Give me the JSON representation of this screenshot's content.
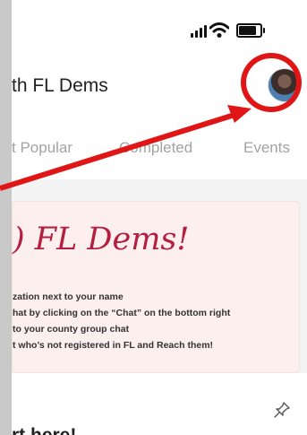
{
  "header": {
    "title": "th FL Dems"
  },
  "tabs": [
    {
      "label": "t Popular"
    },
    {
      "label": "Completed"
    },
    {
      "label": "Events"
    }
  ],
  "announcement": {
    "heading": ") FL Dems!",
    "lines": [
      "zation next to your name",
      "hat by clicking on the “Chat” on the bottom right",
      " to your county group chat",
      "t who’s not registered in FL and Reach them!"
    ]
  },
  "post": {
    "title": "rt here!"
  },
  "icons": {
    "signal": "signal-icon",
    "wifi": "wifi-icon",
    "battery": "battery-icon",
    "avatar": "profile-avatar",
    "pin": "pin-icon"
  },
  "colors": {
    "accent_red": "#e01616",
    "heading_red": "#b51f3f",
    "card_bg": "#fcefee",
    "tab_text": "#a3a3a3"
  }
}
